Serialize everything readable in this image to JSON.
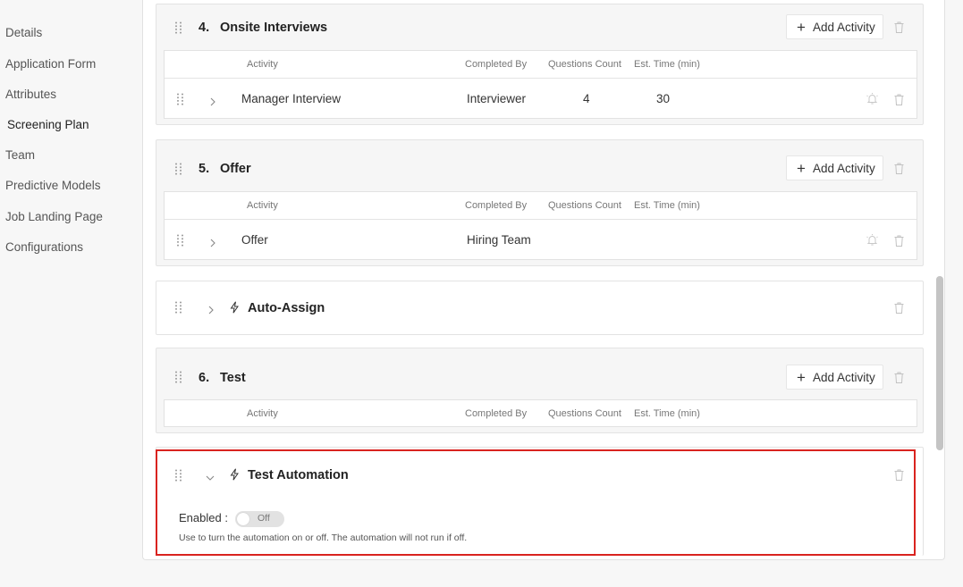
{
  "sidebar": {
    "items": [
      {
        "label": "Details"
      },
      {
        "label": "Application Form"
      },
      {
        "label": "Attributes"
      },
      {
        "label": "Screening Plan"
      },
      {
        "label": "Team"
      },
      {
        "label": "Predictive Models"
      },
      {
        "label": "Job Landing Page"
      },
      {
        "label": "Configurations"
      }
    ]
  },
  "common": {
    "add_activity": "Add Activity",
    "columns": {
      "activity": "Activity",
      "completed_by": "Completed By",
      "questions_count": "Questions Count",
      "est_time": "Est. Time (min)"
    }
  },
  "stages": {
    "onsite": {
      "number": "4.",
      "title": "Onsite Interviews",
      "rows": [
        {
          "activity": "Manager Interview",
          "completed_by": "Interviewer",
          "questions_count": "4",
          "est_time": "30"
        }
      ]
    },
    "offer": {
      "number": "5.",
      "title": "Offer",
      "rows": [
        {
          "activity": "Offer",
          "completed_by": "Hiring Team",
          "questions_count": "",
          "est_time": ""
        }
      ]
    },
    "auto_assign": {
      "title": "Auto-Assign"
    },
    "test": {
      "number": "6.",
      "title": "Test"
    },
    "test_automation": {
      "title": "Test Automation",
      "enabled_label": "Enabled :",
      "toggle_state": "Off",
      "help": "Use to turn the automation on or off. The automation will not run if off."
    }
  },
  "colors": {
    "highlight": "#d9231f",
    "stage_bg": "#f6f6f6",
    "scroll_thumb": "#c4c4c4"
  }
}
